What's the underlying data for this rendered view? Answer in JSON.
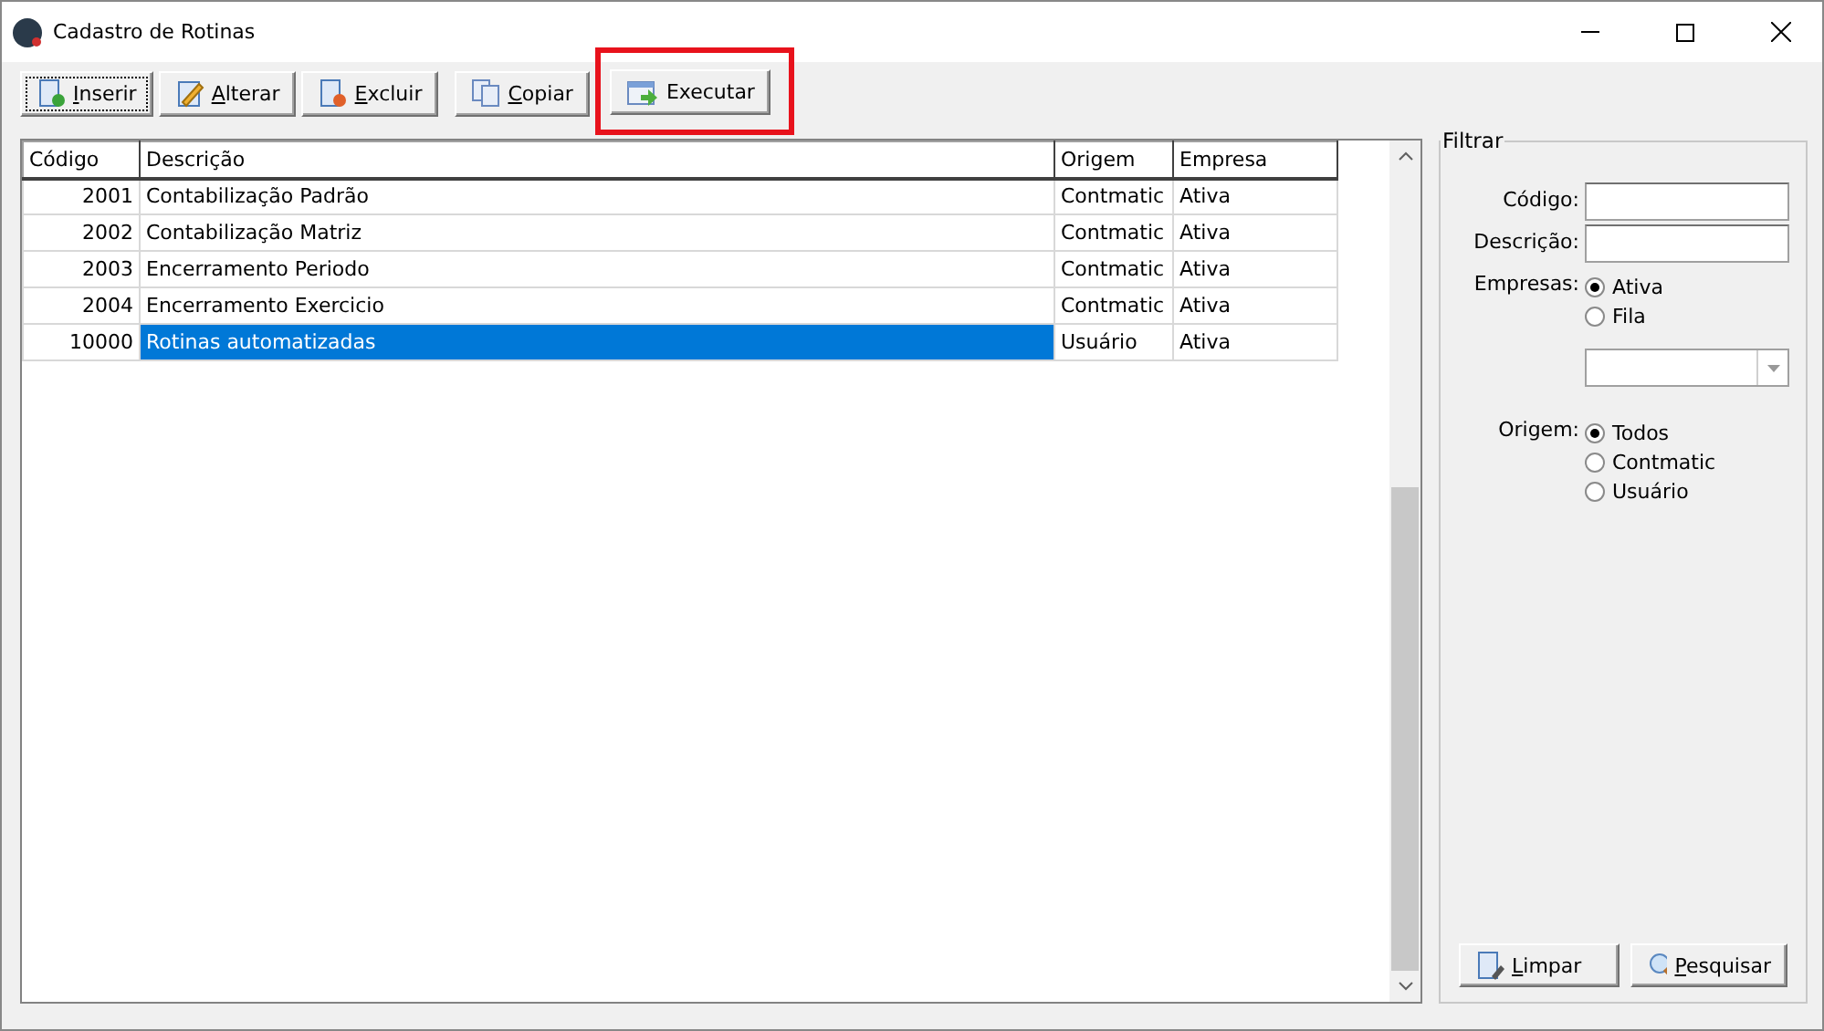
{
  "window": {
    "title": "Cadastro de Rotinas"
  },
  "toolbar": [
    {
      "kind": "insert",
      "accel": "I",
      "rest": "nserir",
      "focused": true,
      "highlighted": false
    },
    {
      "kind": "edit",
      "accel": "A",
      "rest": "lterar",
      "focused": false,
      "highlighted": false
    },
    {
      "kind": "delete",
      "accel": "E",
      "rest": "xcluir",
      "focused": false,
      "highlighted": false
    },
    {
      "kind": "copy",
      "accel": "C",
      "rest": "opiar",
      "focused": false,
      "highlighted": false
    },
    {
      "kind": "run",
      "rest": "Executar",
      "focused": false,
      "highlighted": true
    }
  ],
  "table": {
    "columns": [
      "Código",
      "Descrição",
      "Origem",
      "Empresa"
    ],
    "rows": [
      {
        "cells": [
          "2001",
          "Contabilização Padrão",
          "Contmatic",
          "Ativa"
        ],
        "selected": false
      },
      {
        "cells": [
          "2002",
          "Contabilização Matriz",
          "Contmatic",
          "Ativa"
        ],
        "selected": false
      },
      {
        "cells": [
          "2003",
          "Encerramento Periodo",
          "Contmatic",
          "Ativa"
        ],
        "selected": false
      },
      {
        "cells": [
          "2004",
          "Encerramento Exercicio",
          "Contmatic",
          "Ativa"
        ],
        "selected": false
      },
      {
        "cells": [
          "10000",
          "Rotinas automatizadas",
          "Usuário",
          "Ativa"
        ],
        "selected": true
      }
    ]
  },
  "filter": {
    "title": "Filtrar",
    "fields": [
      {
        "label": "Código:"
      },
      {
        "label": "Descrição:"
      }
    ],
    "empresas": {
      "label": "Empresas:",
      "options": [
        {
          "label": "Ativa",
          "selected": true
        },
        {
          "label": "Fila",
          "selected": false
        }
      ]
    },
    "origem": {
      "label": "Origem:",
      "options": [
        {
          "label": "Todos",
          "selected": true
        },
        {
          "label": "Contmatic",
          "selected": false
        },
        {
          "label": "Usuário",
          "selected": false
        }
      ]
    },
    "buttons": [
      {
        "kind": "clear",
        "accel": "L",
        "rest": "impar"
      },
      {
        "kind": "search",
        "accel": "P",
        "rest": "esquisar"
      }
    ]
  }
}
